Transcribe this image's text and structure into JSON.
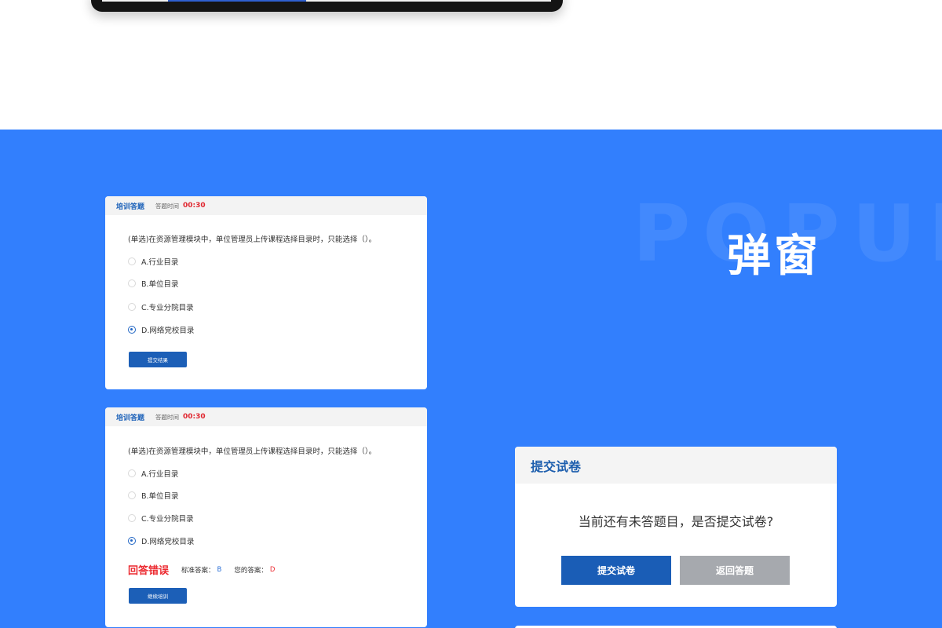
{
  "hero": {
    "en": "POPUP",
    "zh": "弹窗"
  },
  "quiz": {
    "header_title": "培训答题",
    "time_label": "答题时间",
    "time_value": "00:30",
    "question": "(单选)在资源管理模块中，单位管理员上传课程选择目录时，只能选择（）。",
    "options": [
      "A.行业目录",
      "B.单位目录",
      "C.专业分院目录",
      "D.网络党校目录"
    ],
    "selected_option": "D.网络党校目录"
  },
  "card1": {
    "submit_label": "提交结果"
  },
  "card2": {
    "result_title": "回答错误",
    "standard_label": "标准答案：",
    "standard_value": "B",
    "your_label": "您的答案：",
    "your_value": "D",
    "continue_label": "继续培训"
  },
  "dialog": {
    "title": "提交试卷",
    "message": "当前还有未答题目，是否提交试卷?",
    "submit_label": "提交试卷",
    "return_label": "返回答题"
  },
  "colors": {
    "section_bg": "#327ffd",
    "primary_button": "#1a5db6",
    "error_red": "#ec2b31",
    "disabled_button": "#a6a9ae"
  }
}
